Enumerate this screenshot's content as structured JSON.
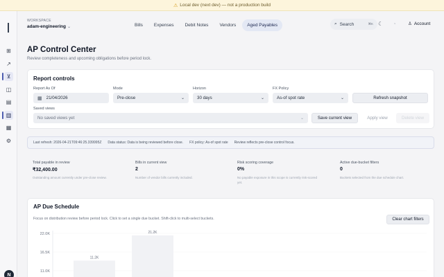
{
  "devbar": {
    "text": "Local dev (next dev) — not a production build"
  },
  "rail": {
    "items": [
      {
        "icon": "grid-icon",
        "glyph": "⊞"
      },
      {
        "icon": "trend-icon",
        "glyph": "↗"
      },
      {
        "icon": "cart-icon",
        "glyph": "⊻"
      },
      {
        "icon": "box-icon",
        "glyph": "◫"
      },
      {
        "icon": "document-icon",
        "glyph": "▤"
      },
      {
        "icon": "chart-icon",
        "glyph": "▥"
      },
      {
        "icon": "ledger-icon",
        "glyph": "▦"
      },
      {
        "icon": "gear-icon",
        "glyph": "⚙"
      }
    ],
    "avatar": "N"
  },
  "topbar": {
    "workspace_label": "WORKSPACE",
    "workspace_name": "adam-engineering",
    "tabs": [
      "Bills",
      "Expenses",
      "Debit Notes",
      "Vendors",
      "Aged Payables"
    ],
    "active_tab": "Aged Payables",
    "search_label": "Search",
    "search_shortcut": "⌘K",
    "account_label": "Account"
  },
  "page": {
    "title": "AP Control Center",
    "subtitle": "Review completeness and upcoming obligations before period lock."
  },
  "report_controls": {
    "title": "Report controls",
    "report_as_of_label": "Report As Of",
    "report_as_of_value": "21/04/2026",
    "mode_label": "Mode",
    "mode_value": "Pre-close",
    "horizon_label": "Horizon",
    "horizon_value": "30 days",
    "fx_label": "FX Policy",
    "fx_value": "As-of spot rate",
    "refresh_button": "Refresh snapshot",
    "saved_views_label": "Saved views",
    "saved_views_placeholder": "No saved views yet",
    "save_button": "Save current view",
    "apply_button": "Apply view",
    "delete_button": "Delete view"
  },
  "status": {
    "last_refresh": "Last refresh: 2026-04-21T09:46:25.339995Z",
    "data_status": "Data status: Data is being reviewed before close.",
    "fx_policy": "FX policy: As-of spot rate",
    "review": "Review reflects pre-close control focus."
  },
  "stats": [
    {
      "label": "Total payable in review",
      "value": "₹32,400.00",
      "note": "Outstanding amount currently under pre-close review."
    },
    {
      "label": "Bills in current view",
      "value": "2",
      "note": "Number of vendor bills currently included."
    },
    {
      "label": "Risk scoring coverage",
      "value": "0%",
      "note": "No payable exposure in this scope is currently risk-scored yet."
    },
    {
      "label": "Active due-bucket filters",
      "value": "0",
      "note": "Buckets selected from the due schedule chart."
    }
  ],
  "schedule": {
    "title": "AP Due Schedule",
    "description": "Focus on distribution review before period lock. Click to set a single due bucket. Shift-click to multi-select buckets.",
    "clear_button": "Clear chart filters"
  },
  "chart_data": {
    "type": "bar",
    "y_ticks": [
      "22.0K",
      "16.5K",
      "11.0K"
    ],
    "ylim": [
      0,
      22000
    ],
    "values": [
      11200,
      21200
    ],
    "value_labels": [
      "11.2K",
      "21.2K"
    ],
    "bar_color": "#f1f2f5"
  }
}
